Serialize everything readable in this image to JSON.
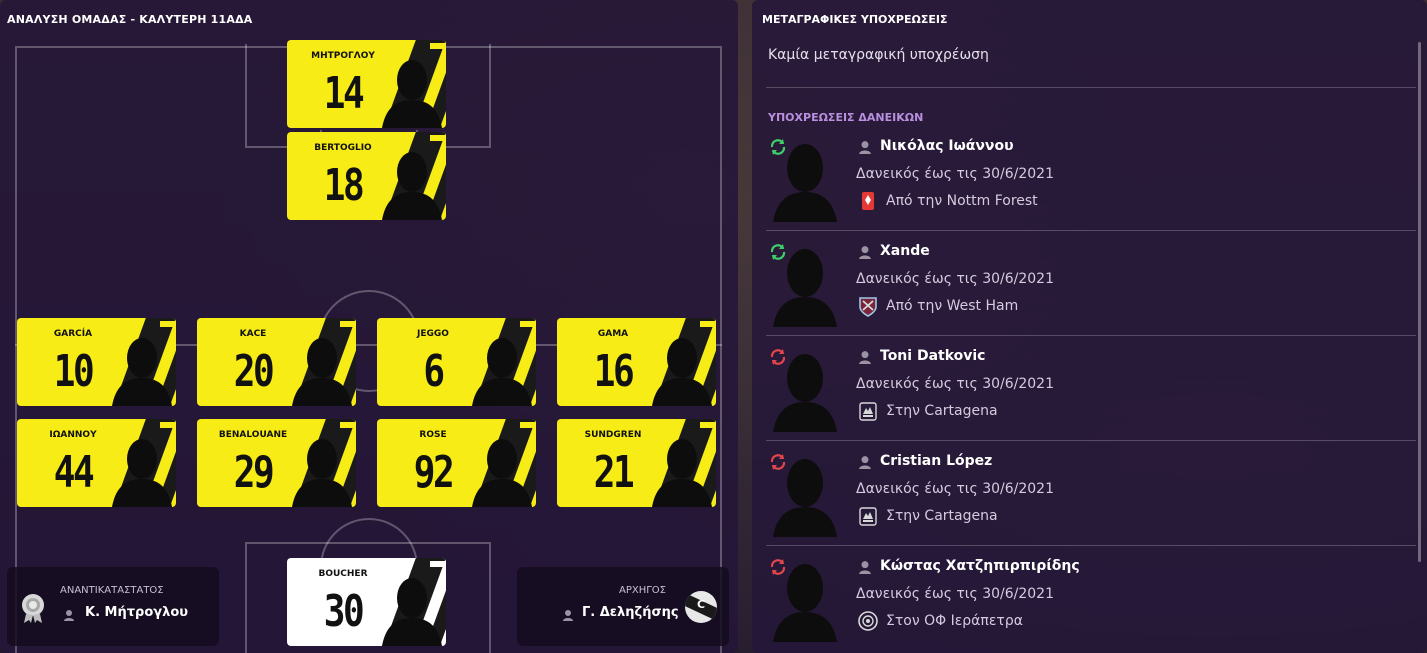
{
  "left_panel": {
    "title": "ΑΝΑΛΥΣΗ ΟΜΑΔΑΣ - ΚΑΛΥΤΕΡΗ 11ΑΔΑ",
    "players": [
      {
        "name": "ΜΗΤΡΟΓΛΟΥ",
        "number": "14",
        "card": "yellow"
      },
      {
        "name": "BERTOGLIO",
        "number": "18",
        "card": "yellow"
      },
      {
        "name": "GARCÍA",
        "number": "10",
        "card": "yellow"
      },
      {
        "name": "KACE",
        "number": "20",
        "card": "yellow"
      },
      {
        "name": "JEGGO",
        "number": "6",
        "card": "yellow"
      },
      {
        "name": "GAMA",
        "number": "16",
        "card": "yellow"
      },
      {
        "name": "ΙΩΑΝΝΟΥ",
        "number": "44",
        "card": "yellow"
      },
      {
        "name": "BENALOUANE",
        "number": "29",
        "card": "yellow"
      },
      {
        "name": "ROSE",
        "number": "92",
        "card": "yellow"
      },
      {
        "name": "SUNDGREN",
        "number": "21",
        "card": "yellow"
      },
      {
        "name": "BOUCHER",
        "number": "30",
        "card": "white"
      }
    ],
    "vice_captain": {
      "label": "ΑΝΑΝΤΙΚΑΤΑΣΤΑΤΟΣ",
      "name": "Κ. Μήτρογλου",
      "icon": "award-rosette-icon"
    },
    "captain": {
      "label": "ΑΡΧΗΓΟΣ",
      "name": "Γ. Δεληζήσης",
      "badge": "C",
      "icon": "captain-armband-icon"
    }
  },
  "right_panel": {
    "title": "ΜΕΤΑΓΡΑΦΙΚΕΣ ΥΠΟΧΡΕΩΣΕΙΣ",
    "no_obligations": "Καμία μεταγραφική υποχρέωση",
    "loans_title": "ΥΠΟΧΡΕΩΣΕΙΣ ΔΑΝΕΙΚΩΝ",
    "loans": [
      {
        "name": "Νικόλας Ιωάννου",
        "until": "Δανεικός έως τις 30/6/2021",
        "club": "Από την Nottm Forest",
        "direction": "in",
        "swap_color": "#3ecf6a",
        "crest": "nottm-forest-crest-icon"
      },
      {
        "name": "Xande",
        "until": "Δανεικός έως τις 30/6/2021",
        "club": "Από την West Ham",
        "direction": "in",
        "swap_color": "#3ecf6a",
        "crest": "west-ham-crest-icon"
      },
      {
        "name": "Toni Datkovic",
        "until": "Δανεικός έως τις 30/6/2021",
        "club": "Στην Cartagena",
        "direction": "out",
        "swap_color": "#e2454a",
        "crest": "cartagena-crest-icon"
      },
      {
        "name": "Cristian López",
        "until": "Δανεικός έως τις 30/6/2021",
        "club": "Στην Cartagena",
        "direction": "out",
        "swap_color": "#e2454a",
        "crest": "cartagena-crest-icon"
      },
      {
        "name": "Κώστας Χατζηπιρπιρίδης",
        "until": "Δανεικός έως τις 30/6/2021",
        "club": "Στον ΟΦ Ιεράπετρα",
        "direction": "out",
        "swap_color": "#e2454a",
        "crest": "of-ierapetra-crest-icon"
      }
    ]
  }
}
